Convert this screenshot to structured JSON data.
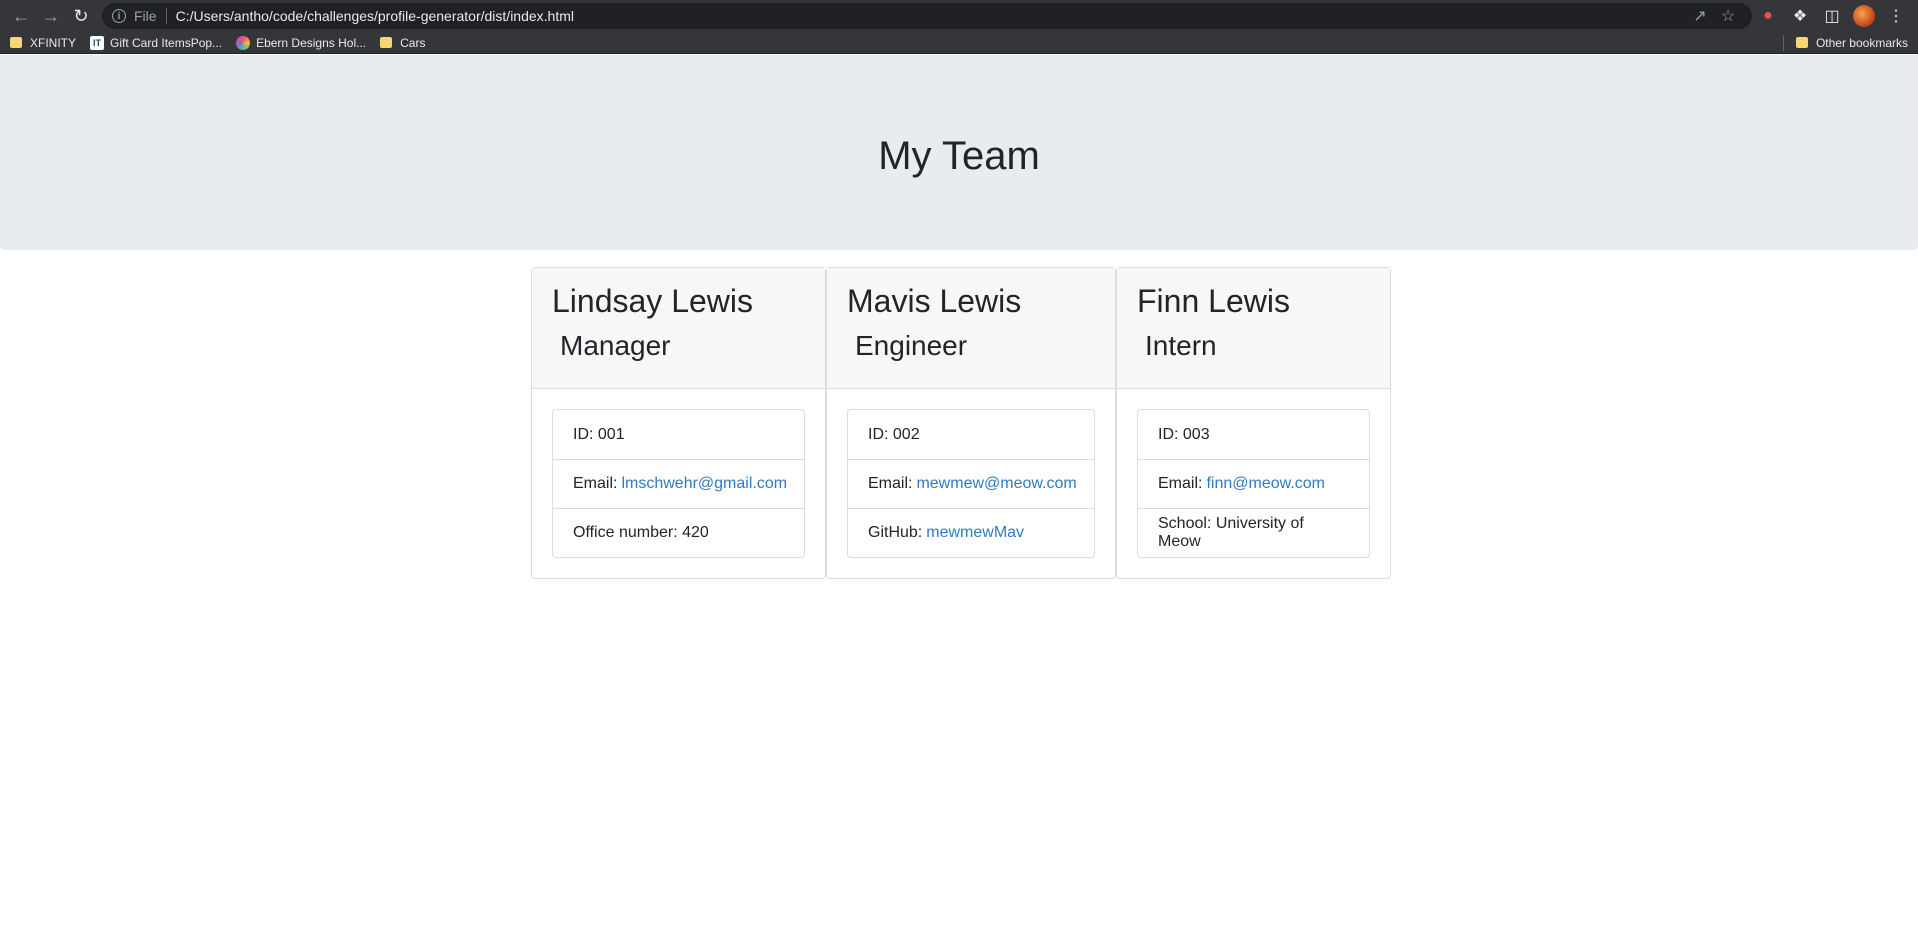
{
  "browser": {
    "file_label": "File",
    "url": "C:/Users/antho/code/challenges/profile-generator/dist/index.html",
    "bookmarks": [
      "XFINITY",
      "Gift Card ItemsPop...",
      "Ebern Designs Hol...",
      "Cars"
    ],
    "other_bookmarks": "Other bookmarks"
  },
  "page": {
    "title": "My Team"
  },
  "team": [
    {
      "name": "Lindsay Lewis",
      "role": "Manager",
      "id_text": "ID: 001",
      "email_label": "Email:",
      "email": "lmschwehr@gmail.com",
      "extra_label": "Office number: 420",
      "extra_link": ""
    },
    {
      "name": "Mavis Lewis",
      "role": "Engineer",
      "id_text": "ID: 002",
      "email_label": "Email:",
      "email": "mewmew@meow.com",
      "extra_label": "GitHub:",
      "extra_link": "mewmewMav"
    },
    {
      "name": "Finn Lewis",
      "role": "Intern",
      "id_text": "ID: 003",
      "email_label": "Email:",
      "email": "finn@meow.com",
      "extra_label": "School: University of Meow",
      "extra_link": ""
    }
  ]
}
